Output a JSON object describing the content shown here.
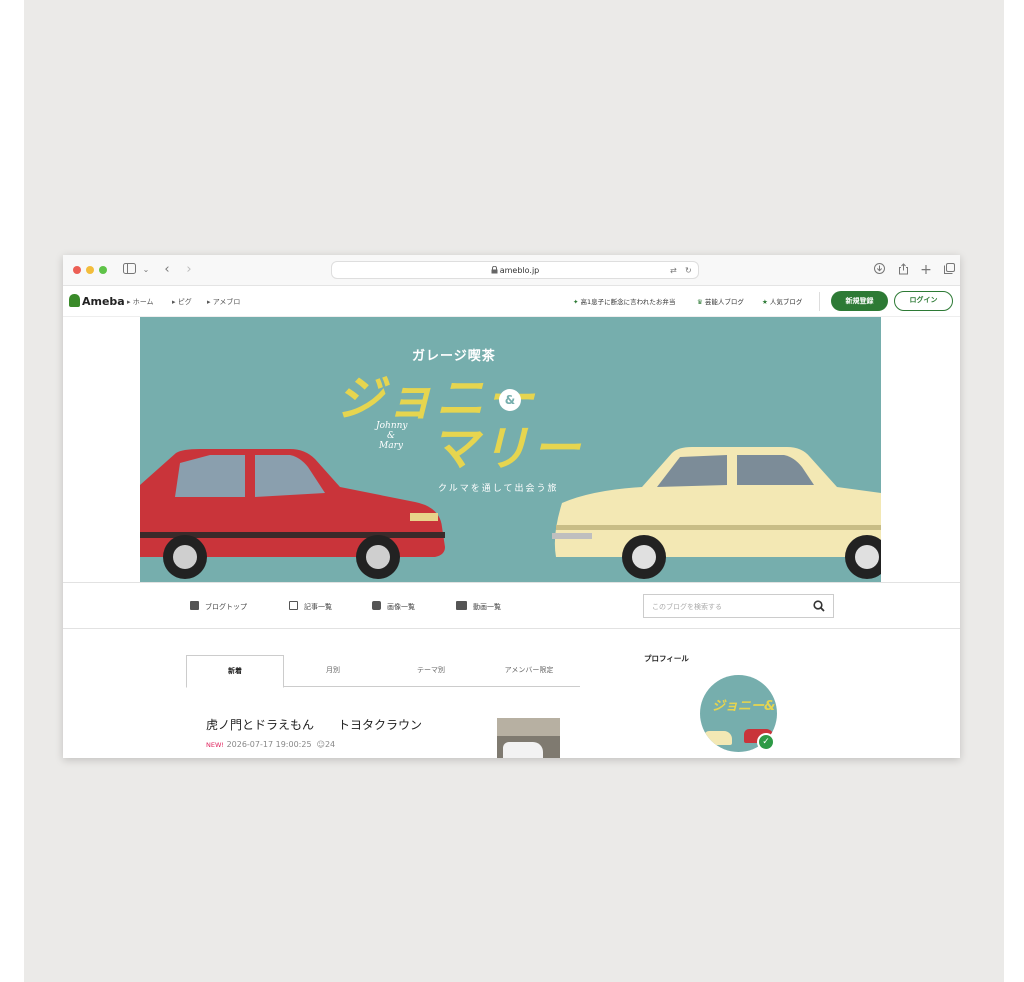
{
  "browser": {
    "url": "ameblo.jp"
  },
  "header": {
    "logo": "Ameba",
    "breadcrumbs": [
      "ホーム",
      "ピグ",
      "アメブロ"
    ],
    "links": [
      "高1息子に断念に言われたお弁当",
      "芸能人ブログ",
      "人気ブログ"
    ],
    "register_label": "新規登録",
    "login_label": "ログイン",
    "accent": "#2d7a35"
  },
  "banner": {
    "subtitle": "ガレージ喫茶",
    "title_line1": "ジョニー",
    "amp": "&",
    "title_line2": "マリー",
    "script": "Johnny & Mary",
    "tagline": "クルマを通して出会う旅",
    "bg": "#76aead"
  },
  "nav": {
    "items": [
      "ブログトップ",
      "記事一覧",
      "画像一覧",
      "動画一覧"
    ],
    "search_placeholder": "このブログを検索する"
  },
  "tabs": [
    "新着",
    "月別",
    "テーマ別",
    "アメンバー限定"
  ],
  "article": {
    "title": "虎ノ門とドラえもん　　トヨタクラウン",
    "new_label": "NEW!",
    "date": "2026-07-17 19:00:25",
    "comments": "24"
  },
  "sidebar": {
    "profile_label": "プロフィール",
    "avatar_text": "ジョニー&マリー"
  }
}
